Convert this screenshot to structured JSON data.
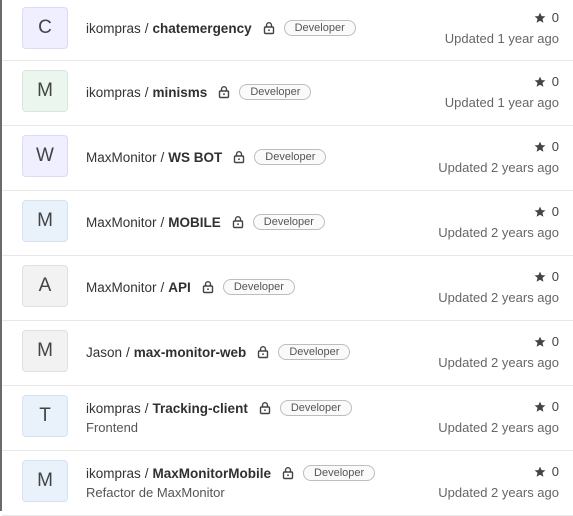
{
  "rows": [
    {
      "avatar": "C",
      "avatar_style": "purple",
      "owner": "ikompras",
      "repo": "chatemergency",
      "role": "Developer",
      "description": "",
      "stars": "0",
      "updated": "Updated 1 year ago"
    },
    {
      "avatar": "M",
      "avatar_style": "green",
      "owner": "ikompras",
      "repo": "minisms",
      "role": "Developer",
      "description": "",
      "stars": "0",
      "updated": "Updated 1 year ago"
    },
    {
      "avatar": "W",
      "avatar_style": "purple",
      "owner": "MaxMonitor",
      "repo": "WS BOT",
      "role": "Developer",
      "description": "",
      "stars": "0",
      "updated": "Updated 2 years ago"
    },
    {
      "avatar": "M",
      "avatar_style": "blue",
      "owner": "MaxMonitor",
      "repo": "MOBILE",
      "role": "Developer",
      "description": "",
      "stars": "0",
      "updated": "Updated 2 years ago"
    },
    {
      "avatar": "A",
      "avatar_style": "gray",
      "owner": "MaxMonitor",
      "repo": "API",
      "role": "Developer",
      "description": "",
      "stars": "0",
      "updated": "Updated 2 years ago"
    },
    {
      "avatar": "M",
      "avatar_style": "gray",
      "owner": "Jason",
      "repo": "max-monitor-web",
      "role": "Developer",
      "description": "",
      "stars": "0",
      "updated": "Updated 2 years ago"
    },
    {
      "avatar": "T",
      "avatar_style": "blue",
      "owner": "ikompras",
      "repo": "Tracking-client",
      "role": "Developer",
      "description": "Frontend",
      "stars": "0",
      "updated": "Updated 2 years ago"
    },
    {
      "avatar": "M",
      "avatar_style": "blue",
      "owner": "ikompras",
      "repo": "MaxMonitorMobile",
      "role": "Developer",
      "description": "Refactor de MaxMonitor",
      "stars": "0",
      "updated": "Updated 2 years ago"
    }
  ],
  "icons": {
    "lock": "lock-icon",
    "star": "star-icon"
  }
}
